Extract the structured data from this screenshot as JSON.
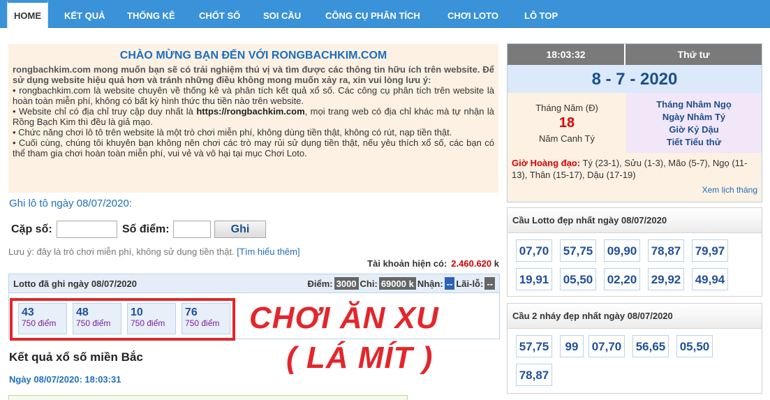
{
  "nav": {
    "items": [
      "HOME",
      "KẾT QUẢ",
      "THỐNG KÊ",
      "CHỐT SỐ",
      "SOI CẦU",
      "CÔNG CỤ PHÂN TÍCH",
      "CHƠI LOTO",
      "LÔ TOP"
    ]
  },
  "welcome": {
    "title": "CHÀO MỪNG BẠN ĐẾN VỚI RONGBACHKIM.COM",
    "intro": "rongbachkim.com mong muốn bạn sẽ có trải nghiệm thú vị và tìm được các thông tin hữu ích trên website. Để sử dụng website hiệu quả hơn và tránh những điều không mong muốn xảy ra, xin vui lòng lưu ý:",
    "b1": "•   rongbachkim.com là website chuyên về thống kê và phân tích kết quả xổ số. Các công cụ phân tích trên website là hoàn toàn miễn phí, không có bất kỳ hình thức thu tiền nào trên website.",
    "b2_pre": "•   Website chỉ có địa chỉ truy cập duy nhất là ",
    "b2_url": "https://rongbachkim.com",
    "b2_post": ", mọi trang web có địa chỉ khác mà tự nhận là Rồng Bạch Kim thì đều là giả mạo.",
    "b3": "•   Chức năng chơi lô tô trên website là một trò chơi miễn phí, không dùng tiền thật, không có rút, nạp tiền thật.",
    "b4": "•   Cuối cùng, chúng tôi khuyên bạn không nên chơi các trò may rủi sử dụng tiền thật, nếu yêu thích xổ số, các bạn có thể tham gia chơi hoàn toàn miễn phí, vui vẻ và vô hại tại mục Chơi Loto."
  },
  "ghi": {
    "title": "Ghi lô tô ngày 08/07/2020:",
    "cap_so_label": "Cặp số:",
    "so_diem_label": "Số điểm:",
    "cap_so_value": "",
    "so_diem_value": "",
    "button": "Ghi",
    "note": "Lưu ý: đây là trò chơi miễn phí, không sử dụng tiền thật.",
    "note_link": "[Tìm hiểu thêm]",
    "account_label": "Tài khoản hiện có:",
    "account_value": "2.460.620",
    "account_unit": "k"
  },
  "lotto": {
    "head_label": "Lotto đã ghi ngày 08/07/2020",
    "diem_label": "Điểm:",
    "diem_value": "3000",
    "chi_label": "Chi:",
    "chi_value": "69000 k",
    "nhan_label": "Nhận:",
    "nhan_value": "--",
    "laile_label": "Lãi-lỗ:",
    "laile_value": "--",
    "cards": [
      {
        "num": "43",
        "pts": "750 điểm"
      },
      {
        "num": "48",
        "pts": "750 điểm"
      },
      {
        "num": "10",
        "pts": "750 điểm"
      },
      {
        "num": "76",
        "pts": "750 điểm"
      }
    ]
  },
  "banner": {
    "line1": "CHƠI ĂN XU",
    "line2": "( LÁ MÍT )",
    "color": "#e3262b"
  },
  "ketqua": {
    "title": "Kết quả xổ số miền Bắc",
    "date": "Ngày 08/07/2020: 18:03:31"
  },
  "calendar": {
    "time": "18:03:32",
    "weekday": "Thứ tư",
    "date": "8 - 7 - 2020",
    "solar_label": "Tháng Năm (Đ)",
    "lunar_day": "18",
    "year_label": "Năm Canh Tý",
    "lunar_month": "Tháng Nhâm Ngọ",
    "lunar_dayname": "Ngày Nhâm Tý",
    "lunar_hour": "Giờ Kỷ Dậu",
    "tiet": "Tiết Tiểu thử",
    "gio_label": "Giờ Hoàng đạo:",
    "gio_value": " Tý (23-1), Sửu (1-3), Mão (5-7), Ngọ (11-13), Thân (15-17), Dậu (17-19)",
    "more": "Xem lịch tháng"
  },
  "cau_lotto": {
    "title": "Cầu Lotto đẹp nhất ngày 08/07/2020",
    "numbers": [
      "07,70",
      "57,75",
      "09,90",
      "78,87",
      "79,97",
      "19,91",
      "05,50",
      "02,20",
      "29,92",
      "49,94"
    ]
  },
  "cau_2nhay": {
    "title": "Cầu 2 nháy đẹp nhất ngày 08/07/2020",
    "numbers": [
      "57,75",
      "99",
      "07,70",
      "56,65",
      "05,50",
      "78,87"
    ]
  }
}
